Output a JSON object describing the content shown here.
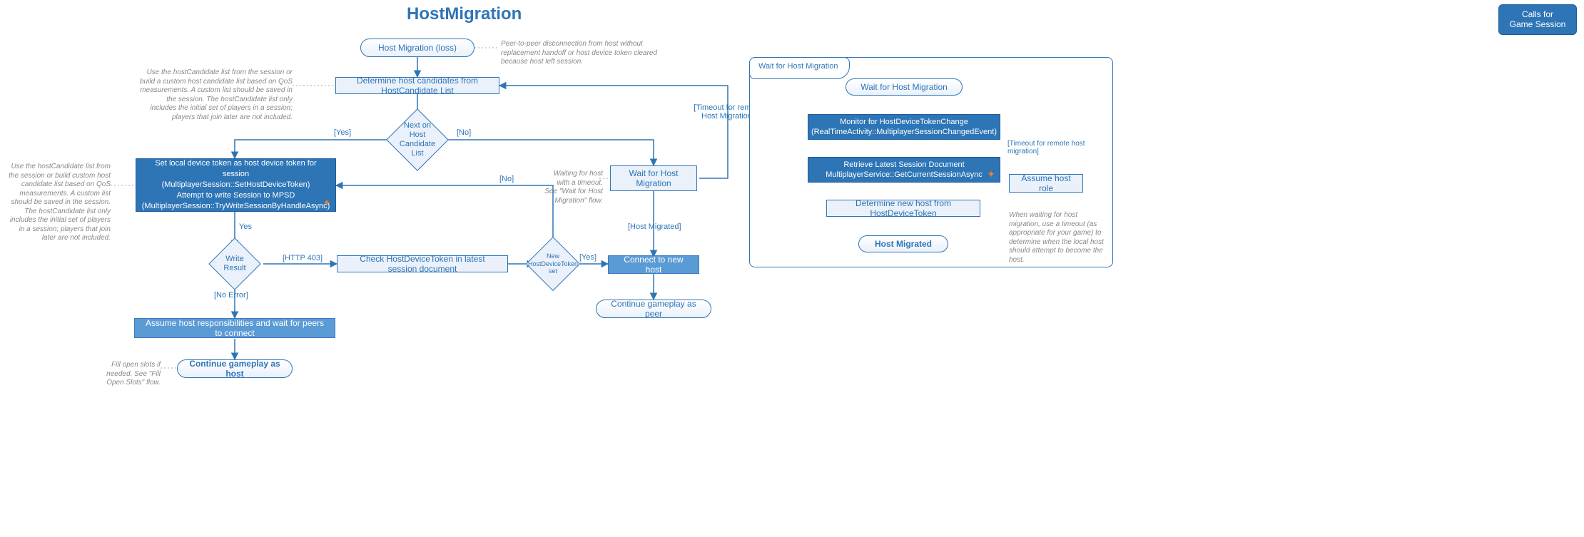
{
  "title": "HostMigration",
  "badge": "Calls for Game Session",
  "nodes": {
    "start": "Host Migration (loss)",
    "determine": "Determine host candidates from HostCandidate List",
    "nextlist": "Next on Host Candidate List",
    "setlocal_l1": "Set local device token as host device token for session",
    "setlocal_l2": "(MultiplayerSession::SetHostDeviceToken)",
    "setlocal_l3": "Attempt to write Session to MPSD",
    "setlocal_l4": "(MultiplayerSession::TryWriteSessionByHandleAsync)",
    "writeresult": "Write Result",
    "checktoken": "Check HostDeviceToken in latest session document",
    "newtokenset": "New HostDeviceToken set",
    "waitmig": "Wait for Host Migration",
    "connect": "Connect to new host",
    "cont_peer": "Continue gameplay as peer",
    "assume_host": "Assume host responsibilities and wait for peers to connect",
    "cont_host": "Continue gameplay as host",
    "right": {
      "tab": "Wait for Host Migration",
      "wait_start": "Wait for Host Migration",
      "monitor_l1": "Monitor for HostDeviceTokenChange",
      "monitor_l2": "(RealTimeActivity::MultiplayerSessionChangedEvent)",
      "retrieve_l1": "Retrieve Latest Session Document",
      "retrieve_l2": "MultiplayerService::GetCurrentSessionAsync",
      "detnew": "Determine new host from HostDeviceToken",
      "migrated": "Host Migrated",
      "assume_role": "Assume host role"
    }
  },
  "labels": {
    "yes": "[Yes]",
    "no": "[No]",
    "yes_word": "Yes",
    "timeout_remote": "[Timeout for remote Host Migration]",
    "host_migrated": "[Host Migrated]",
    "http403": "[HTTP 403]",
    "noerror": "[No Error]",
    "timeout_remote2": "[Timeout for remote host migration]"
  },
  "annots": {
    "a_start": "Peer-to-peer disconnection from host without replacement handoff or host device token cleared because host left session.",
    "a_determine": "Use the hostCandidate list from the session or build a custom host candidate list based on QoS measurements. A custom list should be saved in the session. The hostCandidate list only includes the initial set of players in a session; players that join later are not included.",
    "a_setlocal": "Use the hostCandidate list from the session or build custom host candidate list based on QoS measurements. A custom list should be saved in the session. The hostCandidate list only includes the initial set of players in a session; players that join later are not included.",
    "a_wait": "Waiting for host with a timeout. See \"Wait for Host Migration\" flow.",
    "a_fill": "Fill open slots if needed. See \"Fill Open Slots\" flow.",
    "a_right": "When waiting for host migration, use a timeout (as appropriate for your game) to determine when the local host should attempt to become the host."
  }
}
